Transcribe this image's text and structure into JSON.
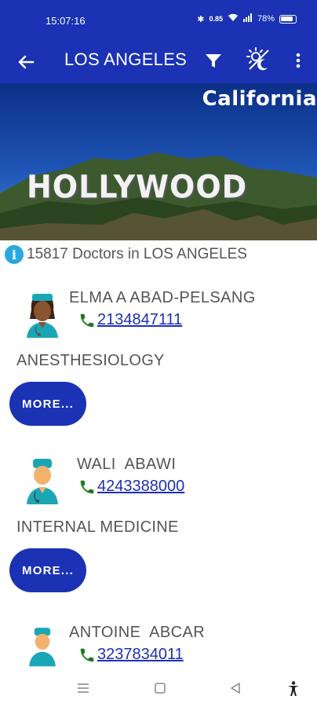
{
  "status": {
    "time": "15:07:16",
    "data_speed": "0.85",
    "battery": "78%"
  },
  "app_bar": {
    "title": "LOS ANGELES"
  },
  "banner": {
    "state": "California",
    "sign": "HOLLYWOOD"
  },
  "count_text": "15817 Doctors in LOS ANGELES",
  "doctors": [
    {
      "name": "ELMA A ABAD-PELSANG",
      "phone": "2134847111",
      "specialty": "ANESTHESIOLOGY",
      "more_label": "MORE..."
    },
    {
      "name": "WALI  ABAWI",
      "phone": "4243388000",
      "specialty": "INTERNAL MEDICINE",
      "more_label": "MORE..."
    },
    {
      "name": "ANTOINE  ABCAR",
      "phone": "3237834011"
    }
  ],
  "colors": {
    "primary": "#1a32b3",
    "phone": "#1e2fb5",
    "phone_icon": "#1b7a1b",
    "info": "#29a8e0"
  }
}
